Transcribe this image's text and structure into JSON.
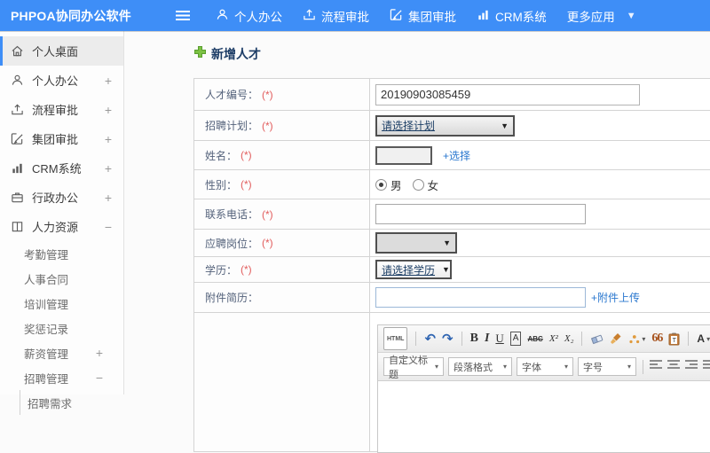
{
  "topbar": {
    "brand": "PHPOA协同办公软件",
    "nav": [
      {
        "label": "个人办公"
      },
      {
        "label": "流程审批"
      },
      {
        "label": "集团审批"
      },
      {
        "label": "CRM系统"
      },
      {
        "label": "更多应用"
      }
    ]
  },
  "icons": {
    "caret_down": "▼",
    "caret_small": "▾"
  },
  "sidebar": {
    "items": [
      {
        "label": "个人桌面",
        "expand": ""
      },
      {
        "label": "个人办公",
        "expand": "+"
      },
      {
        "label": "流程审批",
        "expand": "+"
      },
      {
        "label": "集团审批",
        "expand": "+"
      },
      {
        "label": "CRM系统",
        "expand": "+"
      },
      {
        "label": "行政办公",
        "expand": "+"
      },
      {
        "label": "人力资源",
        "expand": "−"
      }
    ],
    "hr_submenu": [
      {
        "label": "考勤管理",
        "expand": ""
      },
      {
        "label": "人事合同",
        "expand": ""
      },
      {
        "label": "培训管理",
        "expand": ""
      },
      {
        "label": "奖惩记录",
        "expand": ""
      },
      {
        "label": "薪资管理",
        "expand": "+"
      },
      {
        "label": "招聘管理",
        "expand": "−"
      }
    ],
    "recruit_submenu": [
      {
        "label": "招聘需求"
      }
    ]
  },
  "main": {
    "title": "新增人才"
  },
  "form": {
    "rows": [
      {
        "label": "人才编号：",
        "star": "(*)"
      },
      {
        "label": "招聘计划：",
        "star": "(*)"
      },
      {
        "label": "姓名：",
        "star": "(*)"
      },
      {
        "label": "性别：",
        "star": "(*)"
      },
      {
        "label": "联系电话：",
        "star": "(*)"
      },
      {
        "label": "应聘岗位：",
        "star": "(*)"
      },
      {
        "label": "学历：",
        "star": "(*)"
      },
      {
        "label": "附件简历：",
        "star": ""
      },
      {
        "label": "",
        "star": ""
      }
    ],
    "talent_no": "20190903085459",
    "plan_select_value": "请选择计划",
    "name_value": "",
    "name_link": "+选择",
    "gender_options": [
      "男",
      "女"
    ],
    "gender_selected": "男",
    "phone_value": "",
    "post_select_value": "",
    "degree_select_value": "请选择学历",
    "resume_value": "",
    "resume_link": "+附件上传"
  },
  "editor": {
    "source_btn": "HTML",
    "undo": "↶",
    "redo": "↷",
    "bold": "B",
    "italic": "I",
    "underline": "U",
    "boxed_a": "A",
    "strike": "ABC",
    "superscript": "X²",
    "subscript": "X₂",
    "quote": "66",
    "paste_t": "T",
    "font_color": "A",
    "highlight": "ab",
    "dropdowns": [
      {
        "label": "自定义标题"
      },
      {
        "label": "段落格式"
      },
      {
        "label": "字体"
      },
      {
        "label": "字号"
      }
    ]
  }
}
